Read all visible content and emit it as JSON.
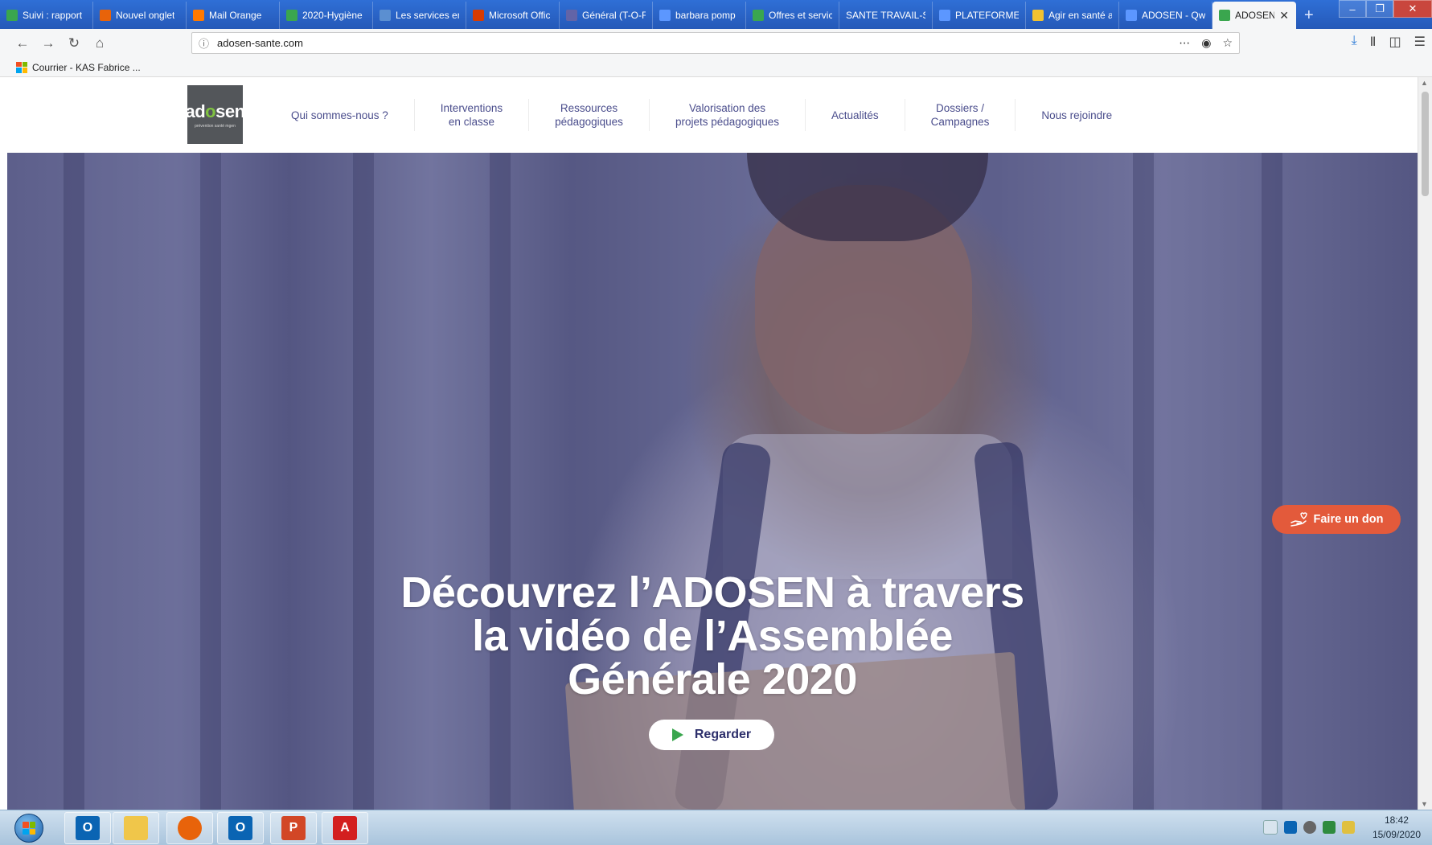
{
  "browser": {
    "tabs": [
      {
        "label": "Suivi : rapport",
        "icon": "green-plus-icon",
        "color": "#3aa64e"
      },
      {
        "label": "Nouvel onglet",
        "icon": "firefox-icon",
        "color": "#e8630a"
      },
      {
        "label": "Mail Orange",
        "icon": "mail-icon",
        "color": "#ff7900"
      },
      {
        "label": "2020-Hygiène",
        "icon": "green-plus-icon",
        "color": "#3aa64e"
      },
      {
        "label": "Les services en",
        "icon": "page-icon",
        "color": "#5b8fd1"
      },
      {
        "label": "Microsoft Offic",
        "icon": "office-icon",
        "color": "#d83b01"
      },
      {
        "label": "Général (T-O-F",
        "icon": "teams-icon",
        "color": "#6264a7"
      },
      {
        "label": "barbara pomp",
        "icon": "qwant-icon",
        "color": "#5c97ff"
      },
      {
        "label": "Offres et servic",
        "icon": "green-plus-icon",
        "color": "#3aa64e"
      },
      {
        "label": "SANTE TRAVAIL-St",
        "icon": "",
        "color": ""
      },
      {
        "label": "PLATEFORME",
        "icon": "qwant-icon",
        "color": "#5c97ff"
      },
      {
        "label": "Agir en santé a",
        "icon": "note-icon",
        "color": "#f2c230"
      },
      {
        "label": "ADOSEN - Qw",
        "icon": "qwant-icon",
        "color": "#5c97ff"
      },
      {
        "label": "ADOSEN - S",
        "icon": "adosen-icon",
        "color": "#3aa64e",
        "active": true
      }
    ],
    "url": "adosen-sante.com",
    "bookmark": "Courrier - KAS Fabrice ..."
  },
  "site": {
    "logo": {
      "word_left": "ad",
      "word_o": "o",
      "word_right": "sen",
      "tagline": "prévention santé mgen"
    },
    "nav": [
      "Qui sommes-nous ?",
      "Interventions\nen classe",
      "Ressources\npédagogiques",
      "Valorisation des\nprojets pédagogiques",
      "Actualités",
      "Dossiers /\nCampagnes",
      "Nous rejoindre"
    ],
    "hero": {
      "title": "Découvrez l’ADOSEN à travers\nla vidéo de l’Assemblée\nGénérale 2020",
      "button": "Regarder"
    },
    "donate": "Faire un don"
  },
  "taskbar": {
    "apps": [
      {
        "name": "outlook",
        "icon": "outlook-icon",
        "glyph": "O",
        "color": "#0a64b3"
      },
      {
        "name": "explorer",
        "icon": "folder-icon",
        "glyph": "",
        "color": "#f0c64a"
      },
      {
        "name": "firefox",
        "icon": "firefox-icon",
        "glyph": "",
        "color": "#e8630a"
      },
      {
        "name": "outlook2",
        "icon": "outlook-icon",
        "glyph": "O",
        "color": "#0a64b3"
      },
      {
        "name": "powerpoint",
        "icon": "powerpoint-icon",
        "glyph": "P",
        "color": "#d24726"
      },
      {
        "name": "acrobat",
        "icon": "acrobat-icon",
        "glyph": "A",
        "color": "#d31f1f"
      }
    ],
    "time": "18:42",
    "date": "15/09/2020"
  },
  "colors": {
    "nav_text": "#4a4d8c",
    "donate": "#e35a3b",
    "play": "#3aa64e",
    "logo_bg": "#53565a",
    "logo_accent": "#7fc241"
  }
}
